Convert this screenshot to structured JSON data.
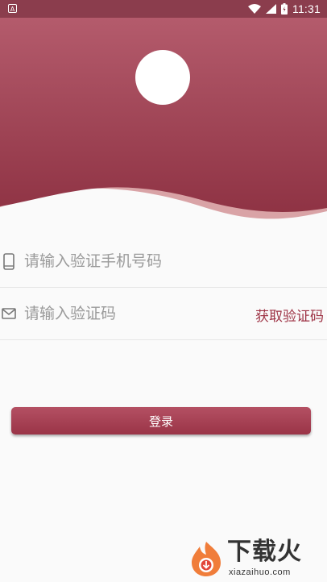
{
  "status_bar": {
    "time": "11:31",
    "notification_label": "A"
  },
  "form": {
    "phone_placeholder": "请输入验证手机号码",
    "code_placeholder": "请输入验证码",
    "get_code_label": "获取验证码"
  },
  "login": {
    "label": "登录"
  },
  "watermark": {
    "title": "下载火",
    "subtitle": "xiazaihuo.com"
  },
  "colors": {
    "brand": "#9e3345",
    "header_top": "#b45b6c",
    "header_bottom": "#8f3344",
    "wave_light": "#d9a3a6"
  }
}
